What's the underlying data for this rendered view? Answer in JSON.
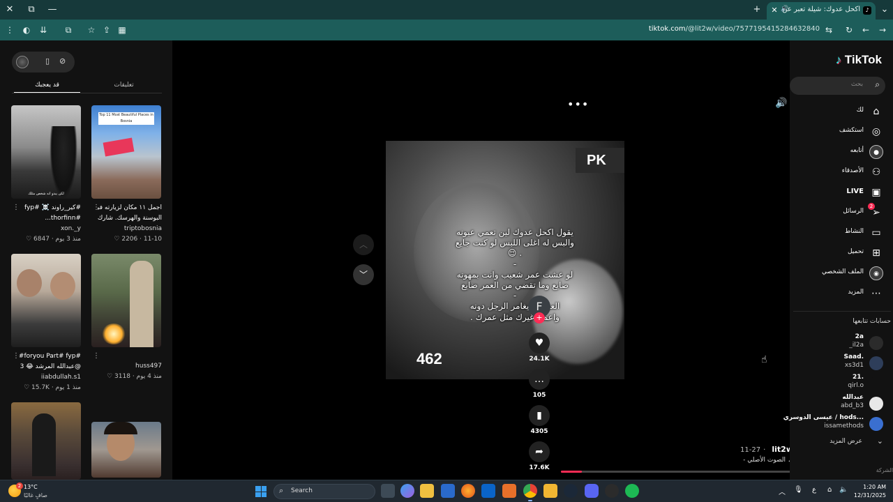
{
  "browser": {
    "tab_title": "اكحل عدوك: شيلة تعبر عن ال...",
    "url_host": "tiktok.com",
    "url_path": "/@lit2w/video/7577195415284632840"
  },
  "left_panel": {
    "tabs": {
      "liked": "قد يعجبك",
      "comments": "تعليقات"
    },
    "videos": [
      {
        "title1": "#كير_راوند ☠️ #fyp",
        "title2": "#thorfinn...",
        "user": "xon._y",
        "views": "6847",
        "time": "منذ 3 يوم",
        "caption": "لكن يبدو انه شخص مثلك"
      },
      {
        "title1": "اجمل ١١ مكان لزيارته في",
        "title2": "البوسنة والهرسك. شارك...",
        "user": "triptobosnia",
        "views": "2206",
        "time": "11-10",
        "caption": "Top 11 Most Beautiful Places in Bosnia"
      },
      {
        "title1": "#foryou Part# fyp#",
        "title2": "@عبدالله المرشد 😂 3",
        "user": "iiabdullah.s1",
        "views": "15.7K",
        "time": "منذ 1 يوم",
        "caption": ""
      },
      {
        "title1": "",
        "title2": "",
        "user": "huss497",
        "views": "3118",
        "time": "منذ 4 يوم",
        "caption": ""
      },
      {
        "title1": "",
        "title2": "",
        "user": "",
        "views": "",
        "time": "",
        "caption": ""
      },
      {
        "title1": "",
        "title2": "",
        "user": "",
        "views": "",
        "time": "",
        "caption": ""
      }
    ]
  },
  "player": {
    "overlay_text": "يقول اكحل عدوك لين تعمي عيونه\nوالبس له اغلى اللبس لو كنت جايع\n. 😌\n-\nلو عشت عمر شعيب وانت بمهونه\nضايع وما تقضي من العمر ضايع\n-\nالعز يوم يغامر الرجل دونه\nواعمار غيرك مثل عمرك .",
    "pk_label": "PK",
    "live_number": "462",
    "author_initial": "F",
    "likes": "24.1K",
    "comments": "105",
    "saves": "4305",
    "shares": "17.6K",
    "username": "lit2w",
    "date": "11-27",
    "sound": "الصوت الأصلي -",
    "progress": 0.09
  },
  "sidebar": {
    "logo": "TikTok",
    "search_placeholder": "بحث",
    "nav": [
      {
        "label": "لك",
        "icon": "home-icon",
        "glyph": "⌂"
      },
      {
        "label": "استكشف",
        "icon": "compass-icon",
        "glyph": "◎"
      },
      {
        "label": "أتابعه",
        "icon": "following-icon",
        "glyph": "●"
      },
      {
        "label": "الأصدقاء",
        "icon": "friends-icon",
        "glyph": "⚇"
      },
      {
        "label": "LIVE",
        "icon": "live-icon",
        "glyph": "▣"
      },
      {
        "label": "الرسائل",
        "icon": "messages-icon",
        "glyph": "➢",
        "badge": "2"
      },
      {
        "label": "النشاط",
        "icon": "activity-icon",
        "glyph": "▭"
      },
      {
        "label": "تحميل",
        "icon": "upload-icon",
        "glyph": "⊞"
      },
      {
        "label": "الملف الشخصي",
        "icon": "profile-avatar-icon",
        "glyph": "◉"
      },
      {
        "label": "المزيد",
        "icon": "more-icon",
        "glyph": "⋯"
      }
    ],
    "following_heading": "حسابات تتابعها",
    "following": [
      {
        "name": "2a",
        "handle": "_il2a",
        "color": "#2b2b2b"
      },
      {
        "name": "Saad.",
        "handle": "xs3d1",
        "color": "#2e3e5a"
      },
      {
        "name": "21.",
        "handle": "qirl.o",
        "color": "#121212"
      },
      {
        "name": "عبدالله",
        "handle": "abd_b3",
        "color": "#e8e8e8"
      },
      {
        "name": "عيسى الدوسري / hods...",
        "handle": "issamethods",
        "color": "#3a6fd0"
      }
    ],
    "see_more": "عرض المزيد",
    "company": "الشركة"
  },
  "taskbar": {
    "temp": "13°C",
    "condition": "صافٍ غالبًا",
    "search": "Search",
    "time": "1:20 AM",
    "date": "12/31/2025",
    "lang": "ع"
  }
}
